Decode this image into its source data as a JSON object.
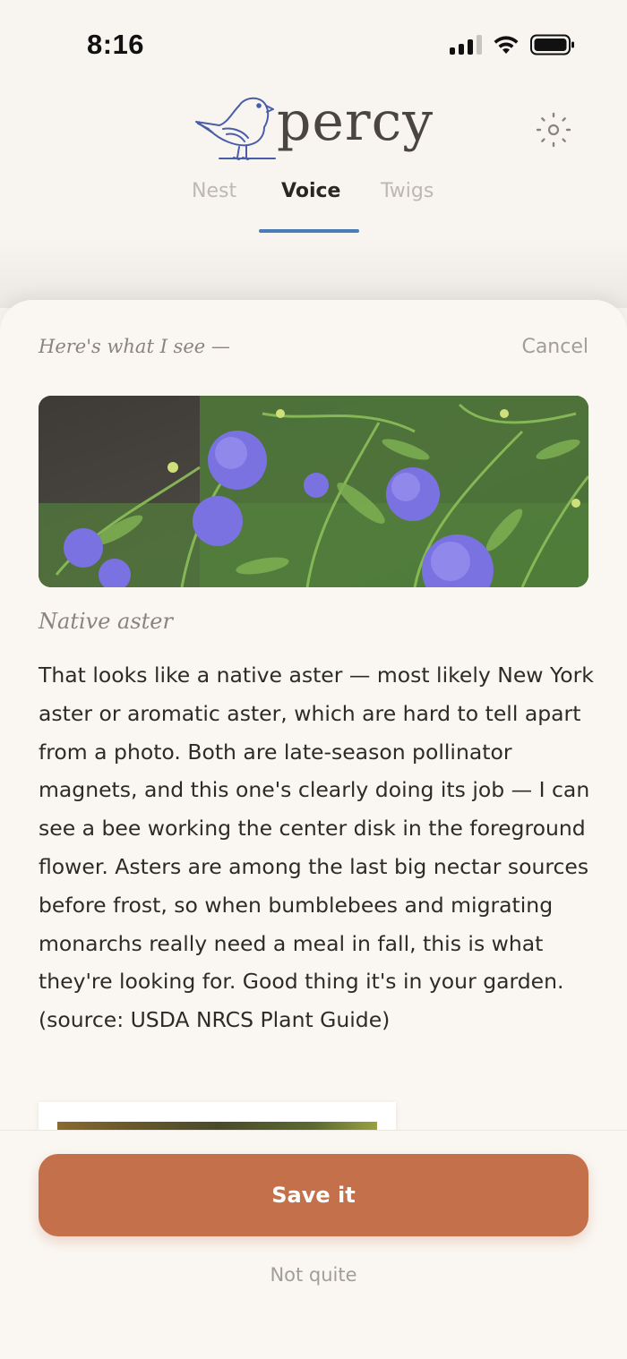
{
  "status_bar": {
    "time": "8:16"
  },
  "header": {
    "logo_text": "percy",
    "tabs": [
      {
        "label": "Nest",
        "active": false
      },
      {
        "label": "Voice",
        "active": true
      },
      {
        "label": "Twigs",
        "active": false
      }
    ],
    "accent_color": "#4b7cb5"
  },
  "sheet": {
    "intro": "Here's what I see —",
    "cancel_label": "Cancel",
    "plant_name": "Native aster",
    "description": "That looks like a native aster — most likely New York aster or aromatic aster, which are hard to tell apart from a photo. Both are late-season pollinator magnets, and this one's clearly doing its job — I can see a bee working the center disk in the foreground flower. Asters are among the last big nectar sources before frost, so when bumblebees and migrating monarchs really need a meal in fall, this is what they're looking for. Good thing it's in your garden. (source: USDA NRCS Plant Guide)"
  },
  "actions": {
    "save_label": "Save it",
    "not_quite_label": "Not quite",
    "save_color": "#c4704a"
  },
  "icons": {
    "logo": "bird-logo-icon",
    "settings": "sun-settings-icon",
    "signal": "cellular-signal-icon",
    "wifi": "wifi-icon",
    "battery": "battery-icon"
  }
}
